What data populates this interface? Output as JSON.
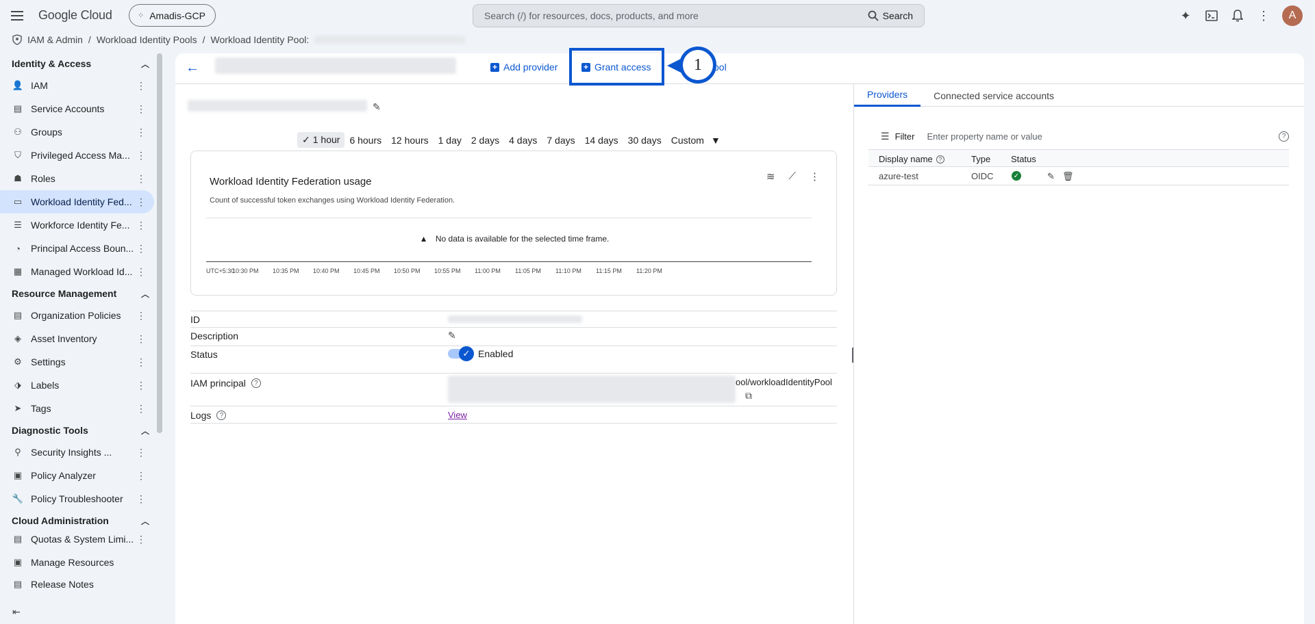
{
  "header": {
    "brand": "Google Cloud",
    "project": "Amadis-GCP",
    "search_placeholder": "Search (/) for resources, docs, products, and more",
    "search_button": "Search",
    "avatar_letter": "A"
  },
  "breadcrumb": {
    "items": [
      "IAM & Admin",
      "Workload Identity Pools",
      "Workload Identity Pool:"
    ],
    "separator": "/"
  },
  "sidebar": {
    "sections": [
      {
        "title": "Identity & Access",
        "items": [
          {
            "label": "IAM",
            "icon": "person-add-icon"
          },
          {
            "label": "Service Accounts",
            "icon": "service-account-icon"
          },
          {
            "label": "Groups",
            "icon": "groups-icon"
          },
          {
            "label": "Privileged Access Ma...",
            "icon": "shield-icon"
          },
          {
            "label": "Roles",
            "icon": "roles-icon"
          },
          {
            "label": "Workload Identity Fed...",
            "icon": "id-card-icon",
            "active": true
          },
          {
            "label": "Workforce Identity Fe...",
            "icon": "list-icon"
          },
          {
            "label": "Principal Access Boun...",
            "icon": "boundary-icon"
          },
          {
            "label": "Managed Workload Id...",
            "icon": "grid-icon"
          }
        ]
      },
      {
        "title": "Resource Management",
        "items": [
          {
            "label": "Organization Policies",
            "icon": "policy-doc-icon"
          },
          {
            "label": "Asset Inventory",
            "icon": "inventory-icon"
          },
          {
            "label": "Settings",
            "icon": "gear-icon"
          },
          {
            "label": "Labels",
            "icon": "label-icon"
          },
          {
            "label": "Tags",
            "icon": "tag-icon"
          }
        ]
      },
      {
        "title": "Diagnostic Tools",
        "items": [
          {
            "label": "Security Insights ...",
            "icon": "insights-icon"
          },
          {
            "label": "Policy Analyzer",
            "icon": "analyzer-icon"
          },
          {
            "label": "Policy Troubleshooter",
            "icon": "wrench-icon"
          }
        ]
      },
      {
        "title": "Cloud Administration",
        "items": [
          {
            "label": "Quotas & System Limi...",
            "icon": "quota-icon"
          }
        ]
      }
    ],
    "bottom_items": [
      {
        "label": "Manage Resources",
        "icon": "manage-resources-icon"
      },
      {
        "label": "Release Notes",
        "icon": "release-notes-icon"
      }
    ]
  },
  "actions": {
    "add_provider": "Add provider",
    "grant_access": "Grant access",
    "third_partial": "ool",
    "callout_number": "1"
  },
  "time_ranges": {
    "options": [
      "1 hour",
      "6 hours",
      "12 hours",
      "1 day",
      "2 days",
      "4 days",
      "7 days",
      "14 days",
      "30 days"
    ],
    "selected": "1 hour",
    "custom": "Custom"
  },
  "chart": {
    "title": "Workload Identity Federation usage",
    "subtitle": "Count of successful token exchanges using Workload Identity Federation.",
    "nodata": "No data is available for the selected time frame.",
    "timezone": "UTC+5:30",
    "ticks": [
      "10:30 PM",
      "10:35 PM",
      "10:40 PM",
      "10:45 PM",
      "10:50 PM",
      "10:55 PM",
      "11:00 PM",
      "11:05 PM",
      "11:10 PM",
      "11:15 PM",
      "11:20 PM"
    ]
  },
  "properties": {
    "id_label": "ID",
    "description_label": "Description",
    "status_label": "Status",
    "status_value": "Enabled",
    "principal_label": "IAM principal",
    "principal_suffix": "ool/workloadIdentityPool",
    "logs_label": "Logs",
    "logs_link": "View"
  },
  "right_panel": {
    "tabs": [
      "Providers",
      "Connected service accounts"
    ],
    "active_tab": "Providers",
    "filter_label": "Filter",
    "filter_placeholder": "Enter property name or value",
    "columns": [
      "Display name",
      "Type",
      "Status"
    ],
    "rows": [
      {
        "display_name": "azure-test",
        "type": "OIDC",
        "status": "ok"
      }
    ]
  }
}
